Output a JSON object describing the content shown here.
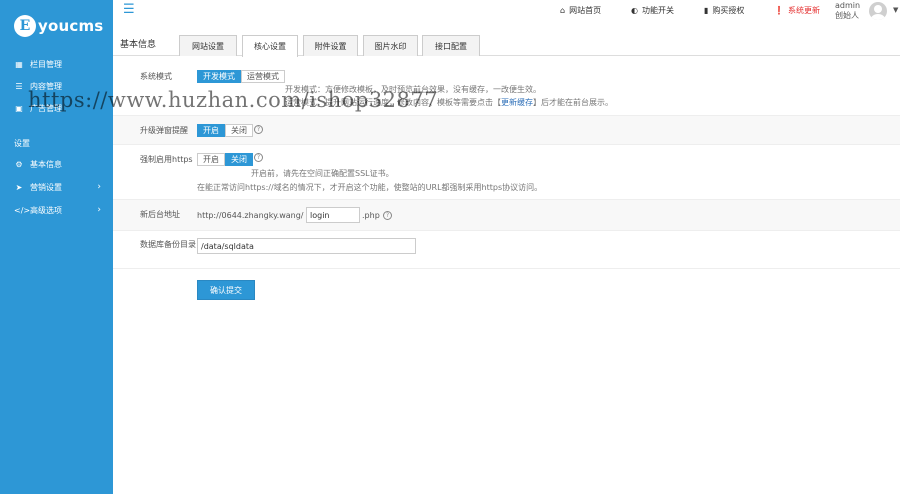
{
  "sidebar": {
    "logo_text": "youcms",
    "items": [
      {
        "label": "栏目管理",
        "icon": "sitemap-icon"
      },
      {
        "label": "内容管理",
        "icon": "list-icon"
      },
      {
        "label": "广告管理",
        "icon": "image-icon"
      }
    ],
    "section_title": "设置",
    "settings_items": [
      {
        "label": "基本信息",
        "icon": "gear-icon"
      },
      {
        "label": "营销设置",
        "icon": "paper-plane-icon"
      },
      {
        "label": "高级选项",
        "icon": "code-icon"
      }
    ]
  },
  "topbar": {
    "site_home": "网站首页",
    "feature_switch": "功能开关",
    "buy_license": "购买授权",
    "system_update": "系统更新",
    "admin_name": "admin",
    "admin_role": "创始人"
  },
  "page": {
    "title": "基本信息",
    "tabs": [
      "网站设置",
      "核心设置",
      "附件设置",
      "图片水印",
      "接口配置"
    ],
    "active_tab": "核心设置"
  },
  "form": {
    "system_mode": {
      "label": "系统模式",
      "options": [
        "开发模式",
        "运营模式"
      ],
      "selected": "开发模式",
      "help_line1": "开发模式：方便修改模板，及时预览前台效果，没有缓存，一改便生效。",
      "help_line2_prefix": "运营模式：提升网站运行速度，修改内容、模板等需要点击【",
      "help_link": "更新缓存",
      "help_line2_suffix": "】后才能在前台展示。"
    },
    "upgrade_popup": {
      "label": "升级弹窗提醒",
      "options": [
        "开启",
        "关闭"
      ],
      "selected": "开启"
    },
    "force_https": {
      "label": "强制启用https",
      "options": [
        "开启",
        "关闭"
      ],
      "selected": "关闭",
      "help_line1": "开启前，请先在空间正确配置SSL证书。",
      "help_line2": "在能正常访问https://域名的情况下，才开启这个功能，使整站的URL都强制采用https协议访问。"
    },
    "admin_url": {
      "label": "新后台地址",
      "prefix": "http://0644.zhangky.wang/",
      "value": "login",
      "suffix": ".php"
    },
    "backup_dir": {
      "label": "数据库备份目录",
      "value": "/data/sqldata"
    },
    "submit_label": "确认提交"
  },
  "watermark": "https://www.huzhan.com/ishop32877"
}
